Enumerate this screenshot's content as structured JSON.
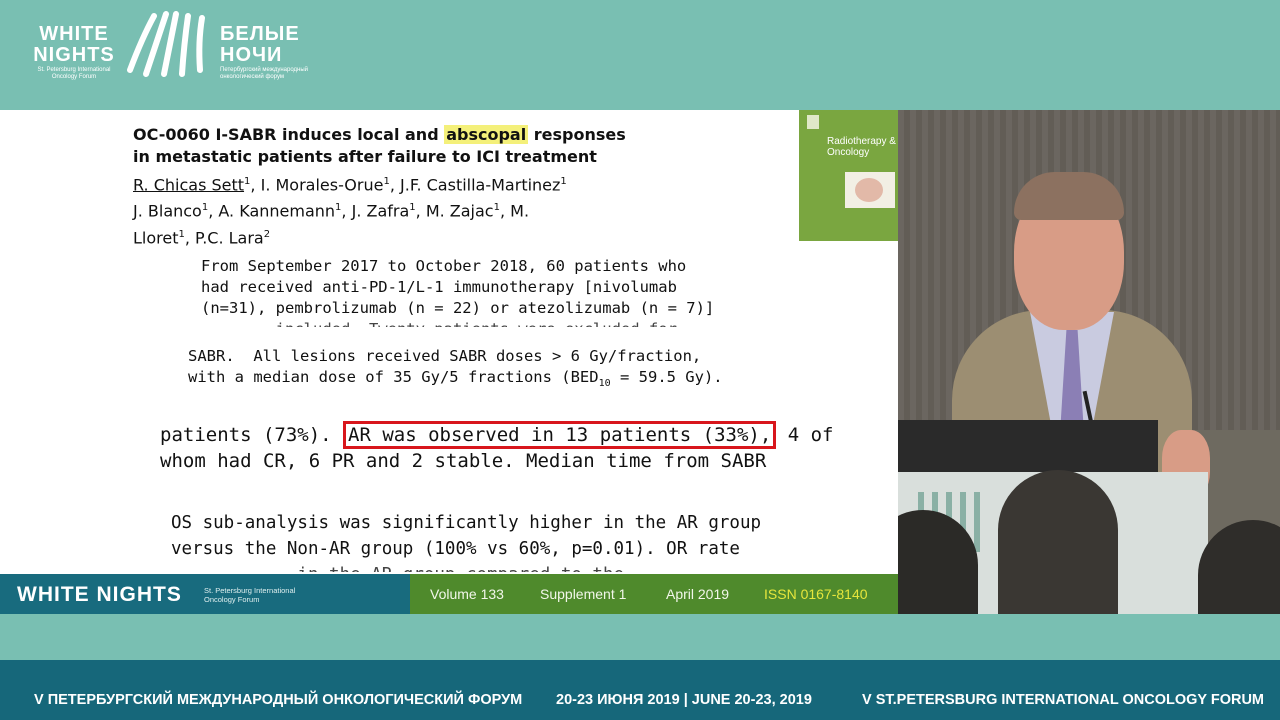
{
  "header": {
    "brand_en": "WHITE NIGHTS",
    "brand_en_sub": "St. Petersburg International Oncology Forum",
    "brand_ru": "БЕЛЫЕ НОЧИ",
    "brand_ru_sub": "Петербургский международный онкологический форум"
  },
  "slide": {
    "paper": {
      "title_pre": "OC-0060 I-SABR induces local and ",
      "title_highlight": "abscopal",
      "title_post": " responses",
      "title_line2": "in metastatic patients after failure to ICI treatment",
      "author_first": "R. Chicas Sett",
      "authors_rest_line1": ", I. Morales-Orue",
      "authors_rest_line1b": ", J.F. Castilla-Martinez",
      "authors_line2a": "J. Blanco",
      "authors_line2b": ", A. Kannemann",
      "authors_line2c": ", J. Zafra",
      "authors_line2d": ", M. Zajac",
      "authors_line2e": ", M.",
      "authors_line3a": "Lloret",
      "authors_line3b": ", P.C. Lara",
      "sup1": "1",
      "sup2": "2"
    },
    "fragment1": {
      "line1": "From September 2017 to October 2018, 60 patients who",
      "line2": "had received anti-PD-1/L-1 immunotherapy [nivolumab",
      "line3": "(n=31), pembrolizumab (n = 22) or atezolizumab (n = 7)]",
      "line4": "        included. Twenty patients were excluded for"
    },
    "fragment2": {
      "line1": "SABR.  All lesions received SABR doses > 6 Gy/fraction,",
      "line2_pre": "with a median dose of 35 Gy/5 fractions (BED",
      "line2_sub": "10",
      "line2_post": " = 59.5 Gy)."
    },
    "fragment3": {
      "pre": "patients (73%). ",
      "boxed": "AR was observed in 13 patients (33%),",
      "post": " 4 of",
      "line2": "whom had CR, 6 PR and 2 stable. Median time from SABR"
    },
    "fragment4": {
      "line1": "OS sub-analysis was significantly higher in the AR group",
      "line2": "versus the Non-AR group (100% vs 60%, p=0.01). OR rate",
      "line3": "            in the AR group compared to the"
    },
    "cover": {
      "journal": "Radiotherapy & Oncology"
    },
    "footer": {
      "brand": "WHITE NIGHTS",
      "brand_sub": "St. Petersburg International Oncology Forum",
      "volume": "Volume 133",
      "supplement": "Supplement 1",
      "date": "April 2019",
      "issn": "ISSN 0167-8140"
    }
  },
  "banner": {
    "ru": "V ПЕТЕРБУРГСКИЙ МЕЖДУНАРОДНЫЙ ОНКОЛОГИЧЕСКИЙ ФОРУМ",
    "dates": "20-23 ИЮНЯ 2019 | JUNE 20-23, 2019",
    "en": "V ST.PETERSBURG INTERNATIONAL ONCOLOGY FORUM"
  },
  "colors": {
    "header_bg": "#79bfb2",
    "banner_bg": "#16677a",
    "highlight": "#f4f07a",
    "box_red": "#d8161c",
    "footer_green": "#4f8a2c",
    "footer_teal": "#186b7e"
  }
}
